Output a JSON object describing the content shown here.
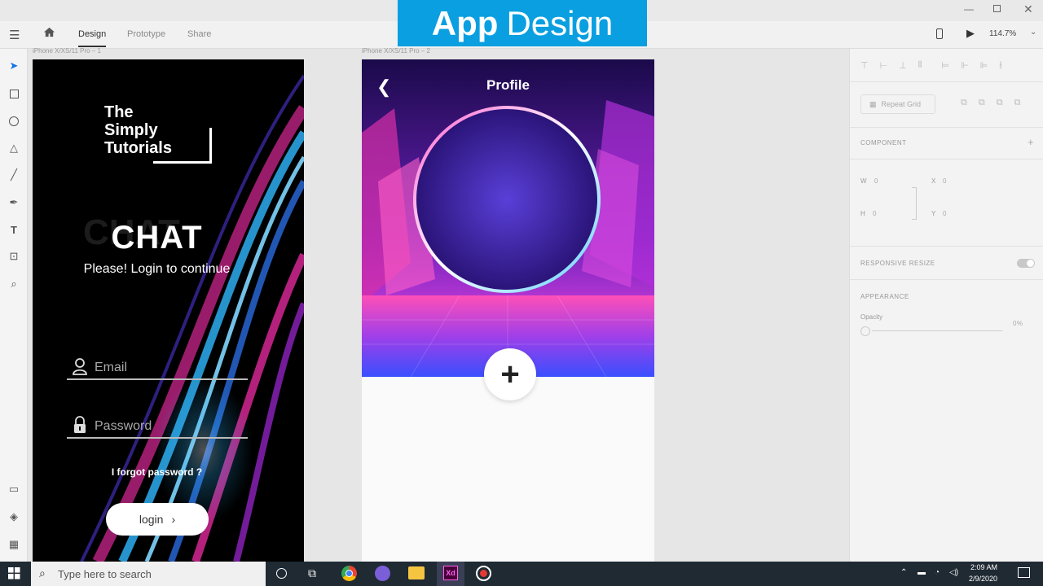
{
  "banner": {
    "bold": "App",
    "regular": "Design"
  },
  "toolbar": {
    "tabs": [
      "Design",
      "Prototype",
      "Share"
    ],
    "zoom": "114.7%"
  },
  "artboard_labels": [
    "iPhone X/XS/11 Pro – 1",
    "iPhone X/XS/11 Pro – 2"
  ],
  "login_screen": {
    "logo_lines": [
      "The",
      "Simply",
      "Tutorials"
    ],
    "chat_title": "CHAT",
    "subtitle": "Please! Login to continue",
    "email_placeholder": "Email",
    "password_placeholder": "Password",
    "forgot": "I forgot password ?",
    "login_button": "login"
  },
  "profile_screen": {
    "title": "Profile",
    "plus": "+"
  },
  "panel": {
    "repeat_grid": "Repeat Grid",
    "component": "COMPONENT",
    "w_label": "W",
    "w_value": "0",
    "x_label": "X",
    "x_value": "0",
    "h_label": "H",
    "h_value": "0",
    "y_label": "Y",
    "y_value": "0",
    "responsive_resize": "RESPONSIVE RESIZE",
    "appearance": "APPEARANCE",
    "opacity_label": "Opacity",
    "opacity_value": "0%"
  },
  "taskbar": {
    "search_placeholder": "Type here to search",
    "time": "2:09 AM",
    "date": "2/9/2020"
  },
  "colors": {
    "banner": "#0a9fe0",
    "taskbar": "#1f2a33",
    "neon_pink": "#ff2fb0",
    "neon_blue": "#2fb8ff"
  }
}
